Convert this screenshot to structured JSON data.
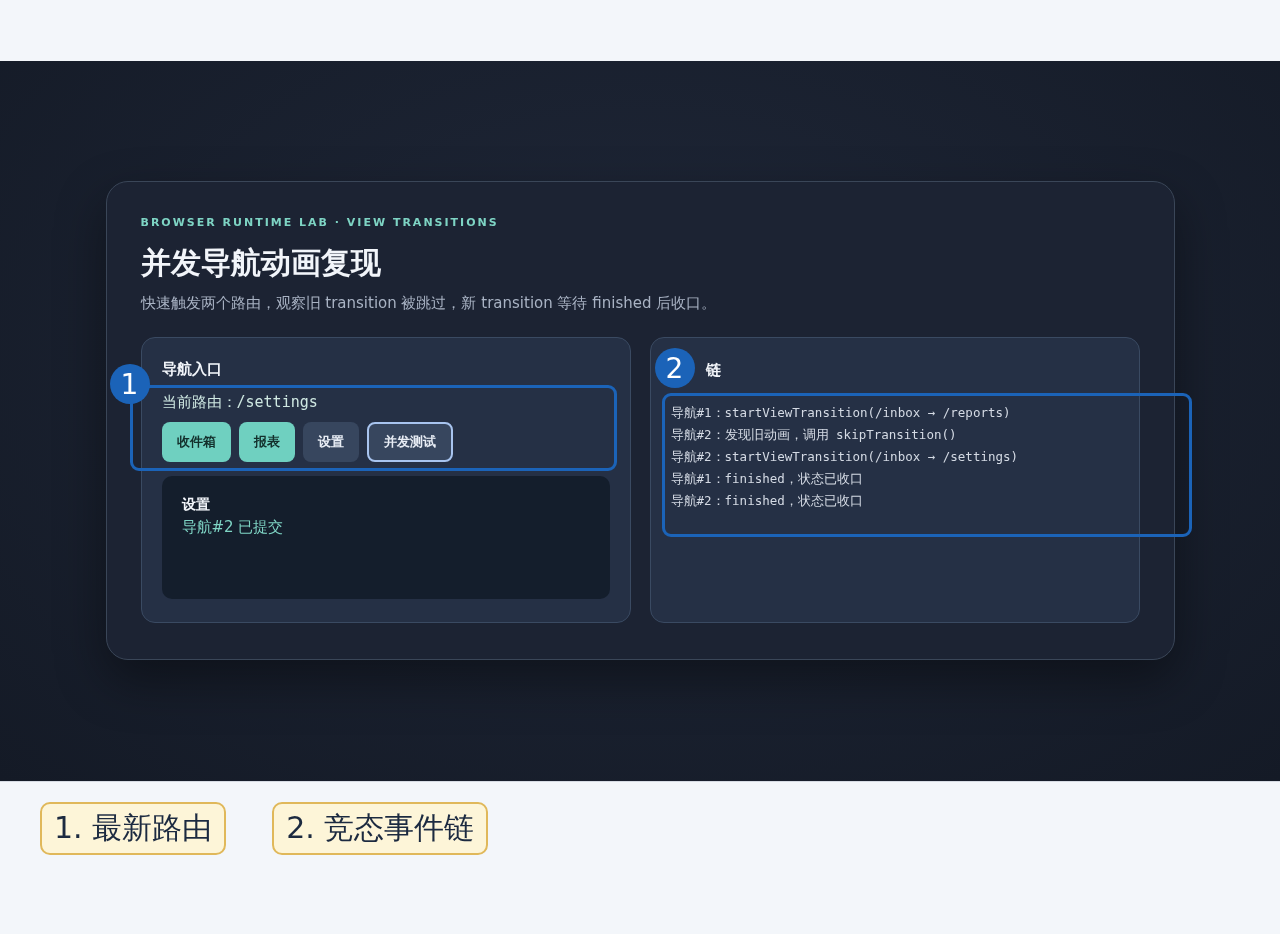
{
  "header": {
    "eyebrow": "BROWSER RUNTIME LAB · VIEW TRANSITIONS",
    "title": "并发导航动画复现",
    "subtitle": "快速触发两个路由，观察旧 transition 被跳过，新 transition 等待 finished 后收口。"
  },
  "nav_panel": {
    "title": "导航入口",
    "route_label": "当前路由：",
    "route_value": "/settings",
    "buttons": [
      {
        "label": "收件箱",
        "kind": "visited"
      },
      {
        "label": "报表",
        "kind": "visited"
      },
      {
        "label": "设置",
        "kind": "current"
      },
      {
        "label": "并发测试",
        "kind": "action"
      }
    ],
    "view": {
      "title": "设置",
      "status": "导航#2 已提交"
    }
  },
  "log_panel": {
    "title": "链",
    "lines": [
      "导航#1：startViewTransition(/inbox → /reports)",
      "导航#2：发现旧动画，调用 skipTransition()",
      "导航#2：startViewTransition(/inbox → /settings)",
      "导航#1：finished，状态已收口",
      "导航#2：finished，状态已收口"
    ]
  },
  "annotations": [
    {
      "number": "1",
      "legend": "1. 最新路由"
    },
    {
      "number": "2",
      "legend": "2. 竞态事件链"
    }
  ]
}
